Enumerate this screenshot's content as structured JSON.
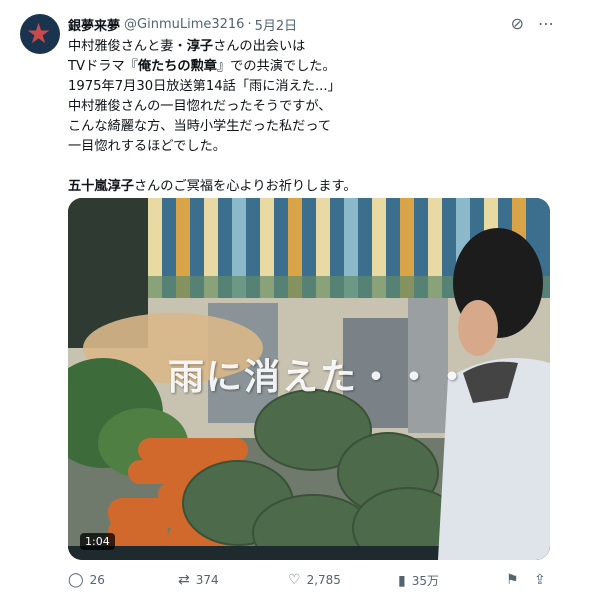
{
  "post": {
    "author_name": "銀夢来夢",
    "handle": "@GinmuLime3216",
    "separator": "·",
    "date": "5月2日",
    "lines": [
      "中村雅俊さんと妻・淳子さんの出会いは",
      "TVドラマ『俺たちの勲章』での共演でした。",
      "1975年7月30日放送第14話「雨に消えた...」",
      "中村雅俊さんの一目惚れだったそうですが、",
      "こんな綺麗な方、当時小学生だった私だって",
      "一目惚れするほどでした。"
    ],
    "closing_name": "五十嵐淳子",
    "closing_rest": "さんのご冥福を心よりお祈りします。",
    "line1_bold": "淳子",
    "line1_pre": "中村雅俊さんと妻・",
    "line1_post": "さんの出会いは",
    "line2_pre": "TVドラマ『",
    "line2_bold": "俺たちの勲章",
    "line2_post": "』での共演でした。"
  },
  "media": {
    "caption": "雨に消えた・・・",
    "duration": "1:04"
  },
  "actions": {
    "replies": "26",
    "reposts": "374",
    "likes": "2,785",
    "views": "35万"
  },
  "icons": {
    "grok": "grok-icon",
    "more": "more-icon",
    "reply": "reply-icon",
    "repost": "repost-icon",
    "like": "like-icon",
    "views": "views-icon",
    "bookmark": "bookmark-icon",
    "share": "share-icon"
  }
}
